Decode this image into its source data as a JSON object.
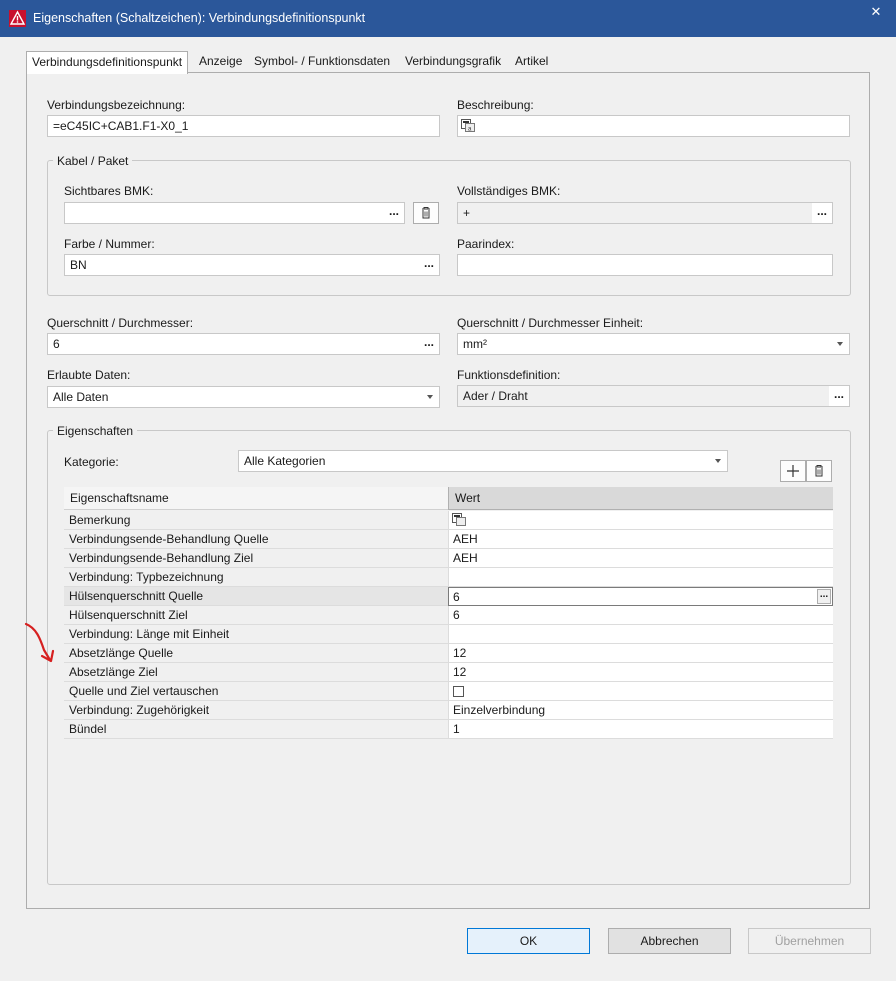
{
  "window": {
    "title": "Eigenschaften (Schaltzeichen): Verbindungsdefinitionspunkt",
    "close_glyph": "✕"
  },
  "tabs": [
    {
      "label": "Verbindungsdefinitionspunkt",
      "active": true
    },
    {
      "label": "Anzeige"
    },
    {
      "label": "Symbol- / Funktionsdaten"
    },
    {
      "label": "Verbindungsgrafik"
    },
    {
      "label": "Artikel"
    }
  ],
  "form": {
    "verbindungsbezeichnung": {
      "label": "Verbindungsbezeichnung:",
      "value": "=eC45IC+CAB1.F1-X0_1"
    },
    "beschreibung": {
      "label": "Beschreibung:",
      "value": ""
    },
    "kabel_group": {
      "title": "Kabel / Paket",
      "sichtbares_bmk": {
        "label": "Sichtbares BMK:",
        "value": ""
      },
      "vollstaendiges_bmk": {
        "label": "Vollständiges BMK:",
        "value": "+"
      },
      "farbe_nummer": {
        "label": "Farbe / Nummer:",
        "value": "BN"
      },
      "paarindex": {
        "label": "Paarindex:",
        "value": ""
      }
    },
    "querschnitt": {
      "label": "Querschnitt / Durchmesser:",
      "value": "6"
    },
    "querschnitt_einheit": {
      "label": "Querschnitt / Durchmesser Einheit:",
      "value": "mm²"
    },
    "erlaubte_daten": {
      "label": "Erlaubte Daten:",
      "value": "Alle Daten"
    },
    "funktionsdefinition": {
      "label": "Funktionsdefinition:",
      "value": "Ader / Draht"
    },
    "dots": "..."
  },
  "eigenschaften": {
    "title": "Eigenschaften",
    "kategorie_label": "Kategorie:",
    "kategorie_value": "Alle Kategorien",
    "columns": [
      "Eigenschaftsname",
      "Wert"
    ],
    "rows": [
      {
        "name": "Bemerkung",
        "value": "",
        "type": "doc"
      },
      {
        "name": "Verbindungsende-Behandlung Quelle",
        "value": "AEH"
      },
      {
        "name": "Verbindungsende-Behandlung Ziel",
        "value": "AEH"
      },
      {
        "name": "Verbindung: Typbezeichnung",
        "value": ""
      },
      {
        "name": "Hülsenquerschnitt Quelle",
        "value": "6",
        "selected": true
      },
      {
        "name": "Hülsenquerschnitt Ziel",
        "value": "6"
      },
      {
        "name": "Verbindung: Länge mit Einheit",
        "value": ""
      },
      {
        "name": "Absetzlänge Quelle",
        "value": "12"
      },
      {
        "name": "Absetzlänge Ziel",
        "value": "12"
      },
      {
        "name": "Quelle und Ziel vertauschen",
        "value": "",
        "type": "checkbox",
        "checked": false
      },
      {
        "name": "Verbindung: Zugehörigkeit",
        "value": "Einzelverbindung"
      },
      {
        "name": "Bündel",
        "value": "1"
      }
    ]
  },
  "buttons": {
    "ok": "OK",
    "abbrechen": "Abbrechen",
    "uebernehmen": "Übernehmen"
  },
  "colors": {
    "titlebar": "#2b579a",
    "app_icon": "#c8102e",
    "annotation_arrow": "#d62020",
    "primary_border": "#0078d7"
  }
}
